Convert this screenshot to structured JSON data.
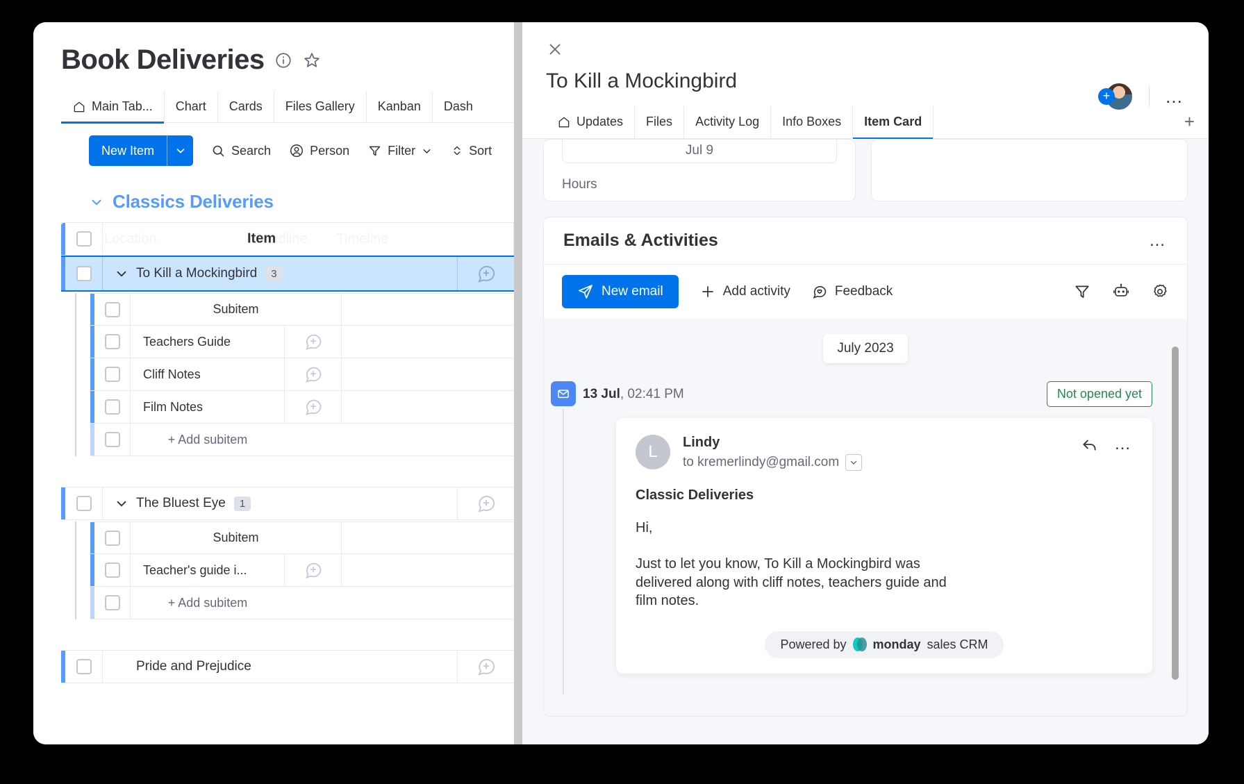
{
  "board": {
    "title": "Book Deliveries",
    "icons": {
      "info": "info-icon",
      "star": "star-icon"
    },
    "view_tabs": [
      {
        "label": "Main Tab...",
        "icon": "home-icon",
        "active": true
      },
      {
        "label": "Chart",
        "active": false
      },
      {
        "label": "Cards",
        "active": false
      },
      {
        "label": "Files Gallery",
        "active": false
      },
      {
        "label": "Kanban",
        "active": false
      },
      {
        "label": "Dash",
        "active": false
      }
    ],
    "toolbar": {
      "new_item": "New Item",
      "search": "Search",
      "person": "Person",
      "filter": "Filter",
      "sort": "Sort"
    },
    "group": {
      "name": "Classics Deliveries"
    },
    "columns": {
      "item": "Item",
      "location": "Location",
      "deadline": "Deadline",
      "timeline": "Timeline"
    },
    "subitem_header": "Subitem",
    "add_subitem": "+ Add subitem",
    "items": [
      {
        "name": "To Kill a Mockingbird",
        "count": "3",
        "selected": true,
        "subitems": [
          "Teachers Guide",
          "Cliff Notes",
          "Film Notes"
        ]
      },
      {
        "name": "The Bluest Eye",
        "count": "1",
        "selected": false,
        "subitems": [
          "Teacher's guide i..."
        ]
      },
      {
        "name": "Pride and Prejudice",
        "count": "",
        "selected": false,
        "subitems": []
      }
    ]
  },
  "item_pane": {
    "title": "To Kill a Mockingbird",
    "close": "close-icon",
    "tabs": [
      {
        "label": "Updates",
        "icon": "home-icon",
        "active": false
      },
      {
        "label": "Files",
        "active": false
      },
      {
        "label": "Activity Log",
        "active": false
      },
      {
        "label": "Info Boxes",
        "active": false
      },
      {
        "label": "Item Card",
        "active": true
      }
    ],
    "add_tab": "+",
    "top_cards": [
      {
        "value": "Jul 9",
        "label": "Hours"
      },
      {
        "value": "",
        "label": ""
      }
    ],
    "emails": {
      "section_title": "Emails & Activities",
      "menu": "…",
      "new_email": "New email",
      "add_activity": "Add activity",
      "feedback": "Feedback",
      "right_icons": [
        "filter-icon",
        "robot-icon",
        "gear-icon"
      ],
      "month_divider": "July 2023",
      "entry": {
        "date_bold": "13 Jul",
        "date_rest": ", 02:41 PM",
        "status": "Not opened yet",
        "sender": "Lindy",
        "sender_initial": "L",
        "recipient": "to kremerlindy@gmail.com",
        "subject": "Classic Deliveries",
        "body": [
          "Hi,",
          "Just to let you know, To Kill a Mockingbird was delivered along with cliff notes, teachers guide and film notes."
        ],
        "powered_prefix": "Powered by",
        "powered_brand": "monday",
        "powered_suffix": "sales CRM"
      }
    }
  },
  "colors": {
    "accent": "#0073ea",
    "group": "#579bfc",
    "selected_row": "#cce5ff",
    "status_green": "#258750",
    "panel_bg": "#f6f7fb"
  }
}
